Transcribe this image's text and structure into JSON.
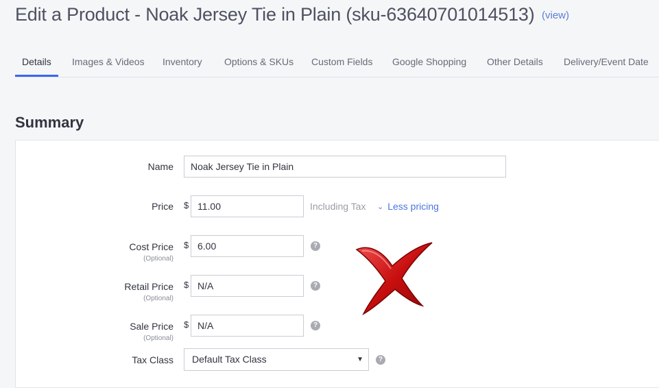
{
  "header": {
    "title": "Edit a Product - Noak Jersey Tie in Plain (sku-63640701014513)",
    "view_link": "(view)"
  },
  "tabs": [
    {
      "label": "Details",
      "active": true
    },
    {
      "label": "Images & Videos"
    },
    {
      "label": "Inventory"
    },
    {
      "label": "Options & SKUs"
    },
    {
      "label": "Custom Fields"
    },
    {
      "label": "Google Shopping"
    },
    {
      "label": "Other Details"
    },
    {
      "label": "Delivery/Event Date"
    }
  ],
  "summary": {
    "title": "Summary",
    "name": {
      "label": "Name",
      "value": "Noak Jersey Tie in Plain"
    },
    "price": {
      "label": "Price",
      "currency": "$",
      "value": "11.00",
      "note": "Including Tax",
      "toggle": "Less pricing"
    },
    "cost_price": {
      "label": "Cost Price",
      "sub": "(Optional)",
      "currency": "$",
      "value": "6.00",
      "help": "?"
    },
    "retail_price": {
      "label": "Retail Price",
      "sub": "(Optional)",
      "currency": "$",
      "value": "N/A",
      "help": "?"
    },
    "sale_price": {
      "label": "Sale Price",
      "sub": "(Optional)",
      "currency": "$",
      "value": "N/A",
      "help": "?"
    },
    "tax_class": {
      "label": "Tax Class",
      "value": "Default Tax Class",
      "help": "?"
    }
  },
  "icons": {
    "chevron": "chevron-down-icon",
    "dropdown": "dropdown-arrow-icon",
    "help": "question-mark-icon",
    "overlay": "red-x-mark"
  },
  "colors": {
    "accent": "#3c64f4",
    "link": "#4a75e0",
    "x_mark": "#d01414"
  }
}
